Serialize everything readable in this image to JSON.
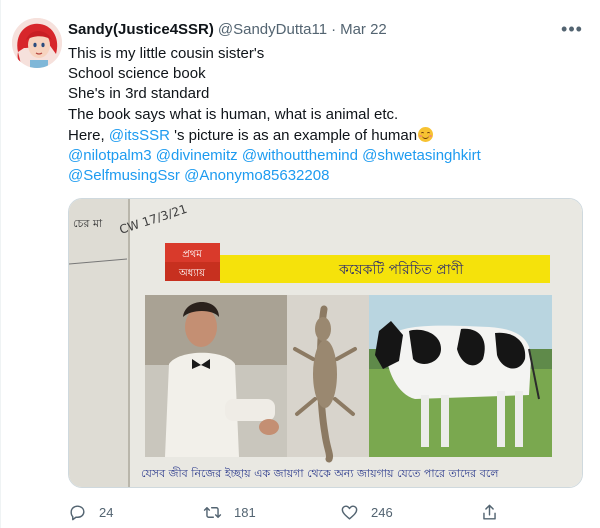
{
  "tweet": {
    "display_name": "Sandy(Justice4SSR)",
    "handle": "@SandyDutta11",
    "separator": "·",
    "date": "Mar 22",
    "more_icon": "more-horizontal-icon",
    "text_lines": [
      "This is my little cousin sister's",
      "School science book",
      "She's in 3rd standard",
      "The book says what is human, what is animal etc."
    ],
    "line5_prefix": "Here, ",
    "line5_mention": "@itsSSR",
    "line5_suffix": " 's picture is as an example of human",
    "emoji": "smiling-face-with-smiling-eyes",
    "mentions_row1": "@nilotpalm3 @divinemitz @withoutthemind @shwetasinghkirt",
    "mentions_row2": "@SelfmusingSsr @Anonymo85632208"
  },
  "media": {
    "handwritten_date": "CW 17/3/21",
    "chapter_label_1": "প্রথম",
    "chapter_label_2": "অধ্যায়",
    "chapter_title": "কয়েকটি পরিচিত প্রাণী",
    "margin_text": "চের মা",
    "bottom_text": "যেসব জীব নিজের ইচ্ছায় এক জায়গা থেকে অন্য জায়গায় যেতে পারে তাদের বলে",
    "colors": {
      "banner": "#f5e20b",
      "chapter_box": "#d93a2b",
      "page": "#ecebe6"
    }
  },
  "actions": {
    "reply_count": "24",
    "retweet_count": "181",
    "like_count": "246",
    "icons": [
      "reply-icon",
      "retweet-icon",
      "like-icon",
      "share-icon"
    ]
  },
  "accent": "#1d9bf0"
}
